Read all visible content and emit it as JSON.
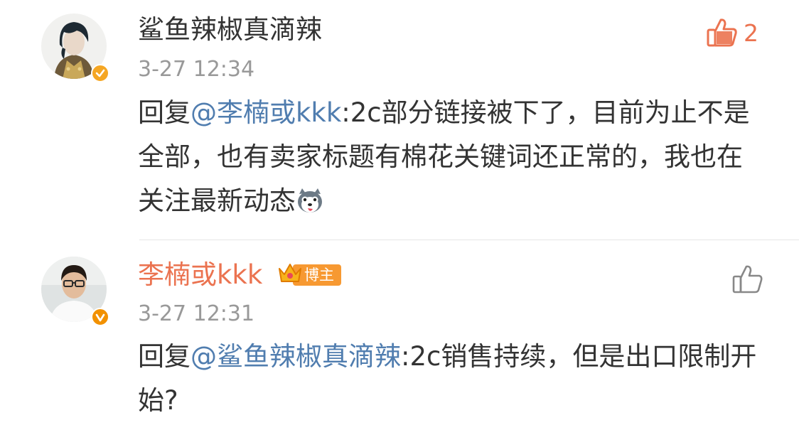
{
  "comments": [
    {
      "username": "鲨鱼辣椒真滴辣",
      "username_color": "#333333",
      "timestamp": "3-27 12:34",
      "reply_prefix": "回复",
      "mention": "@李楠或kkk",
      "body": ":2c部分链接被下了，目前为止不是全部，也有卖家标题有棉花关键词还正常的，我也在关注最新动态",
      "emoji_icon": "husky-dog-emoji-icon",
      "like_count": "2",
      "liked": true,
      "verified_badge_color": "#f5a623"
    },
    {
      "username": "李楠或kkk",
      "username_color": "#eb7350",
      "role_badge": "博主",
      "timestamp": "3-27 12:31",
      "reply_prefix": "回复",
      "mention": "@鲨鱼辣椒真滴辣",
      "body": ":2c销售持续，但是出口限制开始?",
      "liked": false,
      "verified_badge_color": "#f29100"
    }
  ],
  "colors": {
    "mention": "#507daf",
    "like_active": "#eb7350",
    "timestamp": "#999999",
    "role_badge": "#f79932"
  }
}
